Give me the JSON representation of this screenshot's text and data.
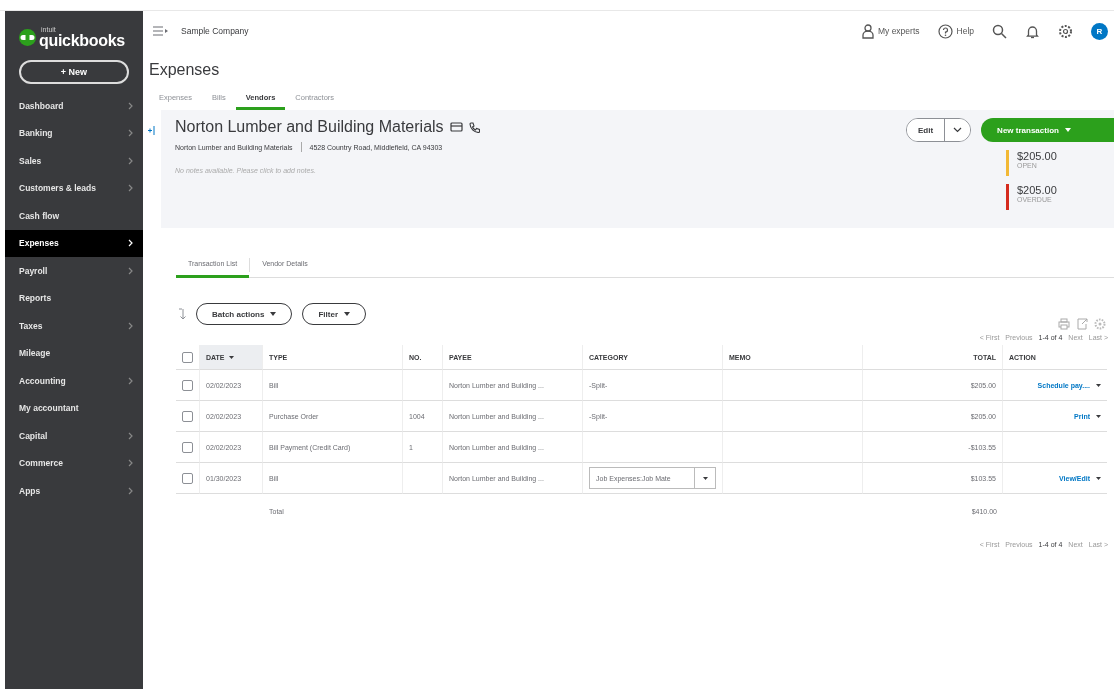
{
  "sidebar": {
    "logo_small": "intuit",
    "logo": "quickbooks",
    "new_button": "+ New",
    "items": [
      {
        "label": "Dashboard",
        "submenu": true,
        "selected": false
      },
      {
        "label": "Banking",
        "submenu": true,
        "selected": false
      },
      {
        "label": "Sales",
        "submenu": true,
        "selected": false
      },
      {
        "label": "Customers & leads",
        "submenu": true,
        "selected": false
      },
      {
        "label": "Cash flow",
        "submenu": false,
        "selected": false
      },
      {
        "label": "Expenses",
        "submenu": true,
        "selected": true
      },
      {
        "label": "Payroll",
        "submenu": true,
        "selected": false
      },
      {
        "label": "Reports",
        "submenu": false,
        "selected": false
      },
      {
        "label": "Taxes",
        "submenu": true,
        "selected": false
      },
      {
        "label": "Mileage",
        "submenu": false,
        "selected": false
      },
      {
        "label": "Accounting",
        "submenu": true,
        "selected": false
      },
      {
        "label": "My accountant",
        "submenu": false,
        "selected": false
      },
      {
        "label": "Capital",
        "submenu": true,
        "selected": false
      },
      {
        "label": "Commerce",
        "submenu": true,
        "selected": false
      },
      {
        "label": "Apps",
        "submenu": true,
        "selected": false
      }
    ]
  },
  "topbar": {
    "company": "Sample Company",
    "my_experts": "My experts",
    "help": "Help",
    "avatar": "R"
  },
  "page_title": "Expenses",
  "tabs": [
    {
      "label": "Expenses",
      "selected": false
    },
    {
      "label": "Bills",
      "selected": false
    },
    {
      "label": "Vendors",
      "selected": true
    },
    {
      "label": "Contractors",
      "selected": false
    }
  ],
  "vendor": {
    "name": "Norton Lumber and Building Materials",
    "company": "Norton Lumber and Building Materials",
    "address": "4528 Country Road, Middlefield, CA 94303",
    "notes_placeholder": "No notes available. Please click to add notes.",
    "edit": "Edit",
    "new_transaction": "New transaction",
    "balances": [
      {
        "amount": "$205.00",
        "label": "OPEN",
        "color": "#f2b835"
      },
      {
        "amount": "$205.00",
        "label": "OVERDUE",
        "color": "#d52b1e"
      }
    ]
  },
  "subtabs": [
    {
      "label": "Transaction List",
      "selected": true
    },
    {
      "label": "Vendor Details",
      "selected": false
    }
  ],
  "toolbar": {
    "batch_actions": "Batch actions",
    "filter": "Filter"
  },
  "pagination_top": {
    "first": "< First",
    "previous": "Previous",
    "range": "1-4 of 4",
    "next": "Next",
    "last": "Last >"
  },
  "table": {
    "select_all": false,
    "columns": [
      {
        "label": "DATE",
        "sorted": true
      },
      {
        "label": "TYPE",
        "sorted": false
      },
      {
        "label": "NO.",
        "sorted": false
      },
      {
        "label": "PAYEE",
        "sorted": false
      },
      {
        "label": "CATEGORY",
        "sorted": false
      },
      {
        "label": "MEMO",
        "sorted": false
      },
      {
        "label": "TOTAL",
        "sorted": false
      },
      {
        "label": "ACTION",
        "sorted": false
      }
    ],
    "rows": [
      {
        "checked": false,
        "date": "02/02/2023",
        "type": "Bill",
        "no": "",
        "payee": "Norton Lumber and Building ...",
        "category": "-Split-",
        "category_dropdown": false,
        "total": "$205.00",
        "action": {
          "label": "Schedule pay....",
          "menu": true
        }
      },
      {
        "checked": false,
        "date": "02/02/2023",
        "type": "Purchase Order",
        "no": "1004",
        "payee": "Norton Lumber and Building ...",
        "category": "-Split-",
        "category_dropdown": false,
        "total": "$205.00",
        "action": {
          "label": "Print",
          "menu": true
        }
      },
      {
        "checked": false,
        "date": "02/02/2023",
        "type": "Bill Payment (Credit Card)",
        "no": "1",
        "payee": "Norton Lumber and Building ...",
        "category": "",
        "category_dropdown": false,
        "total": "-$103.55"
      },
      {
        "checked": false,
        "date": "01/30/2023",
        "type": "Bill",
        "no": "",
        "payee": "Norton Lumber and Building ...",
        "category": "Job Expenses:Job Mate",
        "category_dropdown": true,
        "total": "$103.55",
        "action": {
          "label": "View/Edit",
          "menu": true
        }
      }
    ],
    "total_row": {
      "label": "Total",
      "amount": "$410.00"
    }
  },
  "pagination_bottom": {
    "first": "< First",
    "previous": "Previous",
    "range": "1-4 of 4",
    "next": "Next",
    "last": "Last >"
  }
}
